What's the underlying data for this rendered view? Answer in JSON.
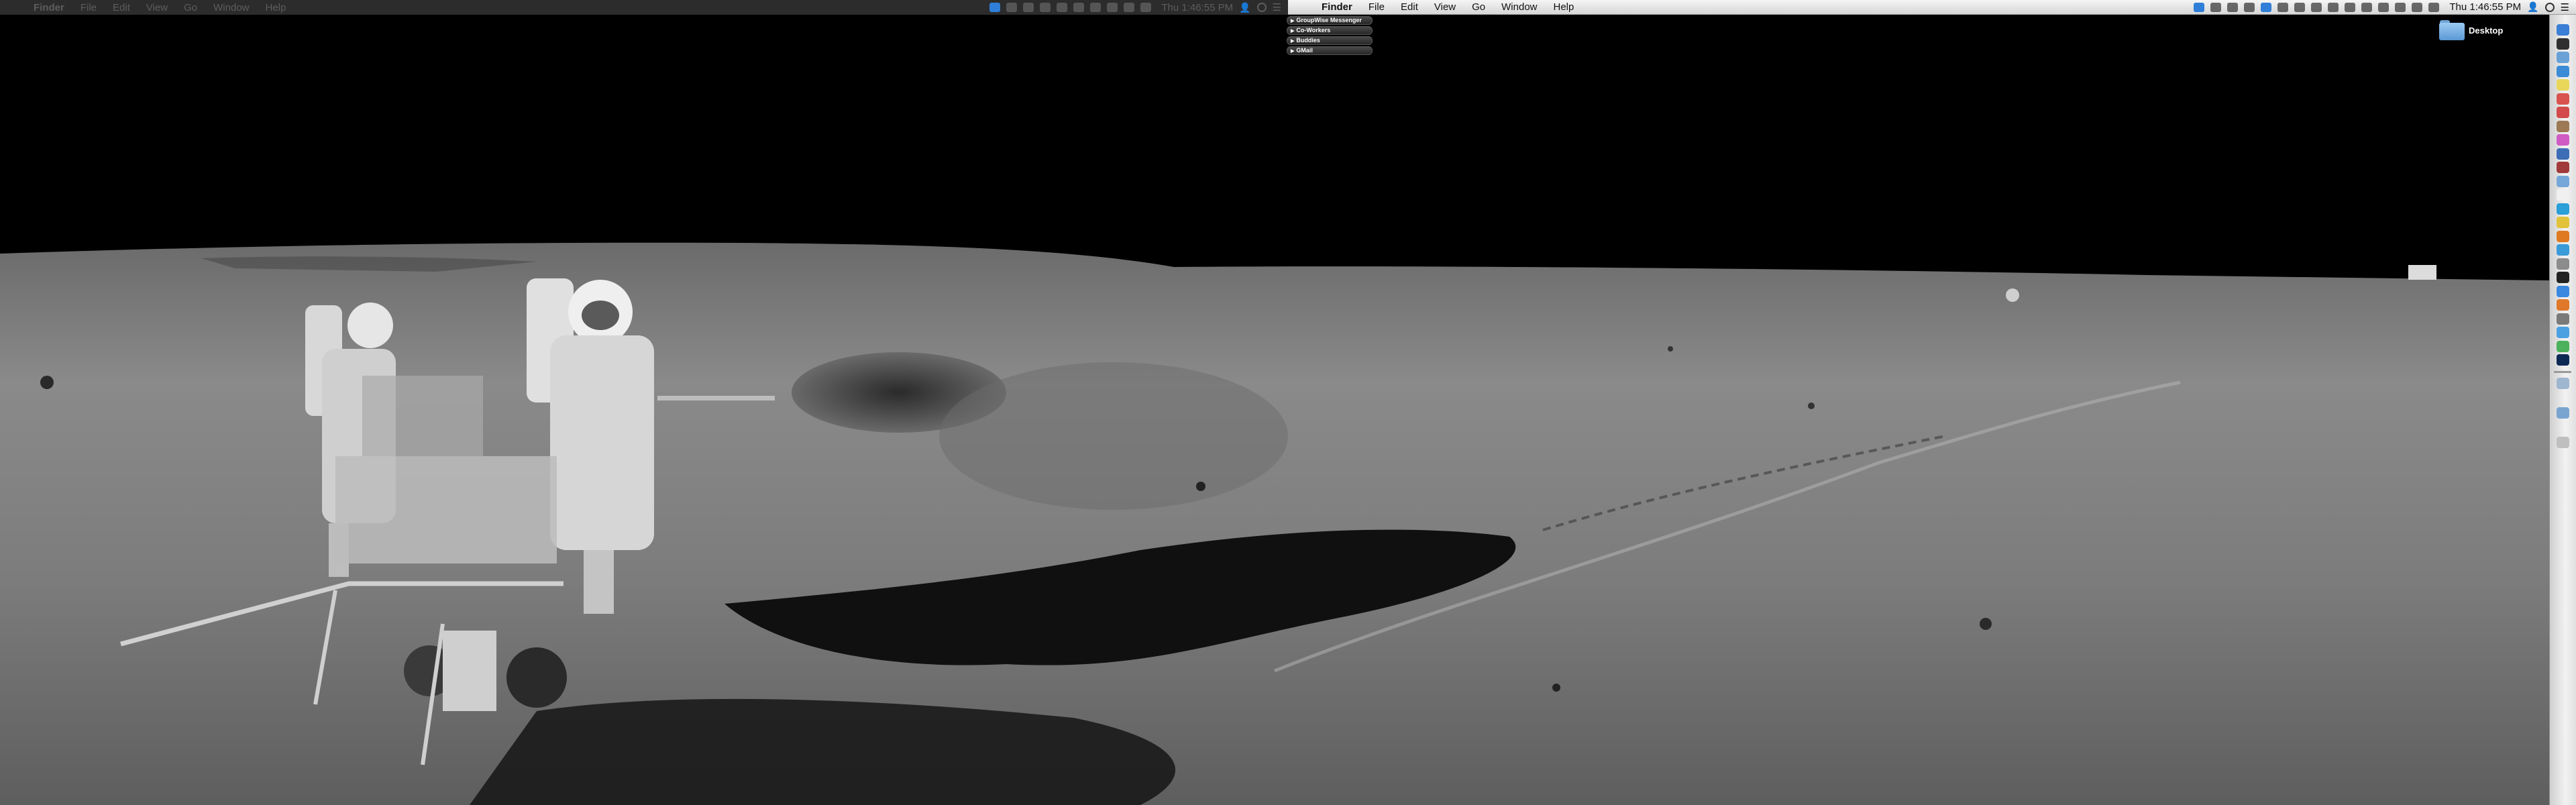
{
  "menubar_left": {
    "apple": "",
    "items": [
      "Finder",
      "File",
      "Edit",
      "View",
      "Go",
      "Window",
      "Help"
    ],
    "clock": "Thu 1:46:55 PM"
  },
  "menubar_right": {
    "apple": "",
    "items": [
      "Finder",
      "File",
      "Edit",
      "View",
      "Go",
      "Window",
      "Help"
    ],
    "clock": "Thu 1:46:55 PM"
  },
  "buddy_list": {
    "groups": [
      "GroupWise Messenger",
      "Co-Workers",
      "Buddies",
      "GMail"
    ]
  },
  "desktop": {
    "icon_label": "Desktop",
    "icon": "folder-icon"
  },
  "dock": {
    "icons": [
      "finder-icon",
      "dashboard-icon",
      "mail-icon",
      "safari-icon",
      "notes-icon",
      "calendar-icon",
      "ical-icon",
      "contacts-icon",
      "itunes-icon",
      "iphoto-icon",
      "photobooth-icon",
      "preview-icon",
      "textedit-icon",
      "skype-icon",
      "chrome-icon",
      "firefox-icon",
      "messages-icon",
      "system-preferences-icon",
      "terminal-icon",
      "app-store-icon",
      "vlc-icon",
      "utilities-icon",
      "xcode-icon",
      "coda-icon",
      "photoshop-icon",
      "documents-icon",
      "downloads-icon",
      "trash-icon"
    ],
    "colors": [
      "#3a7fd5",
      "#2f2f2f",
      "#6aa2d8",
      "#3b8bd6",
      "#e8d75a",
      "#d9534f",
      "#d24a4a",
      "#9c7a56",
      "#d05bc4",
      "#3d6db6",
      "#a13a3a",
      "#76a7d9",
      "#f0f0f0",
      "#2a9fd8",
      "#e2c23a",
      "#e07a20",
      "#3b9ad8",
      "#8c8c8c",
      "#222222",
      "#3a88e0",
      "#e0782a",
      "#7a7a7a",
      "#4aa0e0",
      "#4bb15a",
      "#0d2a55",
      "#9fb6d0",
      "#7aa4d0",
      "#bfbfbf"
    ]
  },
  "wallpaper": {
    "subject": "lunar surface panorama"
  }
}
